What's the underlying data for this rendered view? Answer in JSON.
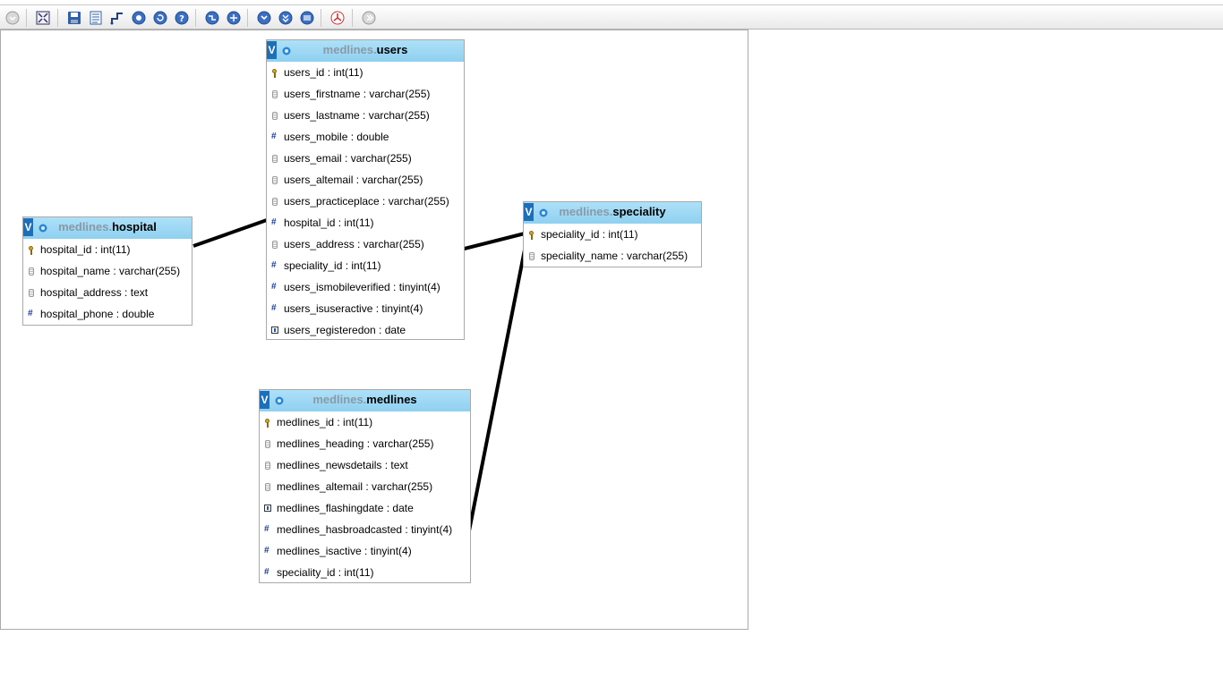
{
  "toolbar": {
    "buttons": [
      {
        "name": "toggle-menu-icon"
      },
      {
        "name": "fullscreen-icon"
      },
      {
        "name": "save-icon"
      },
      {
        "name": "open-page-icon"
      },
      {
        "name": "relation-line-icon"
      },
      {
        "name": "toggle-grid-icon"
      },
      {
        "name": "reload-icon"
      },
      {
        "name": "help-icon"
      },
      {
        "name": "angular-links-icon"
      },
      {
        "name": "snap-to-grid-icon"
      },
      {
        "name": "small-big-all-icon"
      },
      {
        "name": "toggle-small-big-icon"
      },
      {
        "name": "toggle-relation-lines-icon"
      },
      {
        "name": "export-pdf-icon"
      },
      {
        "name": "move-menu-icon"
      }
    ]
  },
  "tables": {
    "users": {
      "schema": "medlines.",
      "name": "users",
      "columns": [
        {
          "text": "users_id : int(11)",
          "type": "key"
        },
        {
          "text": "users_firstname : varchar(255)",
          "type": "txt"
        },
        {
          "text": "users_lastname : varchar(255)",
          "type": "txt"
        },
        {
          "text": "users_mobile : double",
          "type": "num"
        },
        {
          "text": "users_email : varchar(255)",
          "type": "txt"
        },
        {
          "text": "users_altemail : varchar(255)",
          "type": "txt"
        },
        {
          "text": "users_practiceplace : varchar(255)",
          "type": "txt"
        },
        {
          "text": "hospital_id : int(11)",
          "type": "num"
        },
        {
          "text": "users_address : varchar(255)",
          "type": "txt"
        },
        {
          "text": "speciality_id : int(11)",
          "type": "num"
        },
        {
          "text": "users_ismobileverified : tinyint(4)",
          "type": "num"
        },
        {
          "text": "users_isuseractive : tinyint(4)",
          "type": "num"
        },
        {
          "text": "users_registeredon : date",
          "type": "date"
        }
      ]
    },
    "hospital": {
      "schema": "medlines.",
      "name": "hospital",
      "columns": [
        {
          "text": "hospital_id : int(11)",
          "type": "key"
        },
        {
          "text": "hospital_name : varchar(255)",
          "type": "txt"
        },
        {
          "text": "hospital_address : text",
          "type": "txt"
        },
        {
          "text": "hospital_phone : double",
          "type": "num"
        }
      ]
    },
    "speciality": {
      "schema": "medlines.",
      "name": "speciality",
      "columns": [
        {
          "text": "speciality_id : int(11)",
          "type": "key"
        },
        {
          "text": "speciality_name : varchar(255)",
          "type": "txt"
        }
      ]
    },
    "medlines": {
      "schema": "medlines.",
      "name": "medlines",
      "columns": [
        {
          "text": "medlines_id : int(11)",
          "type": "key"
        },
        {
          "text": "medlines_heading : varchar(255)",
          "type": "txt"
        },
        {
          "text": "medlines_newsdetails : text",
          "type": "txt"
        },
        {
          "text": "medlines_altemail : varchar(255)",
          "type": "txt"
        },
        {
          "text": "medlines_flashingdate : date",
          "type": "date"
        },
        {
          "text": "medlines_hasbroadcasted : tinyint(4)",
          "type": "num"
        },
        {
          "text": "medlines_isactive : tinyint(4)",
          "type": "num"
        },
        {
          "text": "speciality_id : int(11)",
          "type": "num"
        }
      ]
    }
  },
  "header_badge": "V"
}
